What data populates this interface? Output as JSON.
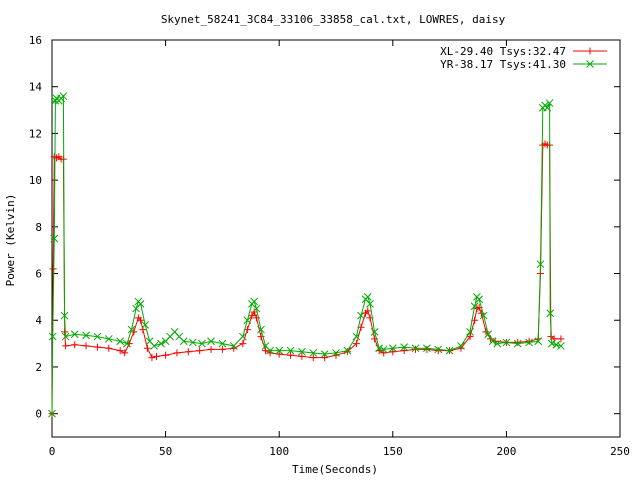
{
  "chart_data": {
    "type": "line",
    "title": "Skynet_58241_3C84_33106_33858_cal.txt, LOWRES, daisy",
    "xlabel": "Time(Seconds)",
    "ylabel": "Power (Kelvin)",
    "xlim": [
      0,
      250
    ],
    "ylim": [
      -1,
      16
    ],
    "xticks": [
      0,
      50,
      100,
      150,
      200,
      250
    ],
    "yticks": [
      0,
      2,
      4,
      6,
      8,
      10,
      12,
      14,
      16
    ],
    "grid": false,
    "legend_position": "top-right",
    "series": [
      {
        "name": "XL-29.40 Tsys:32.47",
        "color": "#ff0000",
        "marker": "+",
        "points": [
          [
            0,
            0
          ],
          [
            0.5,
            6.2
          ],
          [
            1,
            11.0
          ],
          [
            2,
            10.95
          ],
          [
            3,
            11.0
          ],
          [
            4,
            10.9
          ],
          [
            5,
            10.9
          ],
          [
            5.6,
            3.5
          ],
          [
            6,
            2.9
          ],
          [
            10,
            2.95
          ],
          [
            15,
            2.9
          ],
          [
            20,
            2.85
          ],
          [
            25,
            2.8
          ],
          [
            30,
            2.7
          ],
          [
            32,
            2.6
          ],
          [
            34,
            3.0
          ],
          [
            36,
            3.5
          ],
          [
            38,
            4.1
          ],
          [
            39,
            4.0
          ],
          [
            40,
            3.6
          ],
          [
            42,
            2.8
          ],
          [
            44,
            2.4
          ],
          [
            46,
            2.45
          ],
          [
            50,
            2.5
          ],
          [
            55,
            2.6
          ],
          [
            60,
            2.65
          ],
          [
            65,
            2.7
          ],
          [
            70,
            2.75
          ],
          [
            75,
            2.75
          ],
          [
            80,
            2.8
          ],
          [
            84,
            3.0
          ],
          [
            86,
            3.6
          ],
          [
            88,
            4.2
          ],
          [
            89,
            4.35
          ],
          [
            90,
            4.1
          ],
          [
            92,
            3.3
          ],
          [
            94,
            2.7
          ],
          [
            96,
            2.6
          ],
          [
            100,
            2.55
          ],
          [
            105,
            2.5
          ],
          [
            110,
            2.45
          ],
          [
            115,
            2.4
          ],
          [
            120,
            2.4
          ],
          [
            125,
            2.5
          ],
          [
            130,
            2.65
          ],
          [
            134,
            3.0
          ],
          [
            136,
            3.7
          ],
          [
            138,
            4.3
          ],
          [
            139,
            4.4
          ],
          [
            140,
            4.1
          ],
          [
            142,
            3.2
          ],
          [
            144,
            2.7
          ],
          [
            146,
            2.6
          ],
          [
            150,
            2.65
          ],
          [
            155,
            2.7
          ],
          [
            160,
            2.75
          ],
          [
            165,
            2.75
          ],
          [
            170,
            2.7
          ],
          [
            175,
            2.7
          ],
          [
            180,
            2.8
          ],
          [
            184,
            3.3
          ],
          [
            186,
            4.0
          ],
          [
            187,
            4.5
          ],
          [
            188,
            4.55
          ],
          [
            189,
            4.3
          ],
          [
            191,
            3.5
          ],
          [
            193,
            3.2
          ],
          [
            195,
            3.1
          ],
          [
            200,
            3.05
          ],
          [
            205,
            3.05
          ],
          [
            210,
            3.1
          ],
          [
            214,
            3.2
          ],
          [
            215,
            6.0
          ],
          [
            216,
            11.5
          ],
          [
            217,
            11.55
          ],
          [
            218,
            11.5
          ],
          [
            219,
            11.5
          ],
          [
            219.6,
            3.3
          ],
          [
            221,
            3.2
          ],
          [
            224,
            3.2
          ]
        ]
      },
      {
        "name": "YR-38.17 Tsys:41.30",
        "color": "#00aa00",
        "marker": "x",
        "points": [
          [
            0,
            0
          ],
          [
            0.3,
            3.3
          ],
          [
            1,
            7.5
          ],
          [
            1.5,
            13.4
          ],
          [
            2,
            13.5
          ],
          [
            3,
            13.4
          ],
          [
            4,
            13.5
          ],
          [
            5,
            13.6
          ],
          [
            5.5,
            4.2
          ],
          [
            6,
            3.3
          ],
          [
            10,
            3.4
          ],
          [
            15,
            3.35
          ],
          [
            20,
            3.3
          ],
          [
            25,
            3.2
          ],
          [
            30,
            3.1
          ],
          [
            33,
            3.0
          ],
          [
            35,
            3.6
          ],
          [
            37,
            4.5
          ],
          [
            38,
            4.8
          ],
          [
            39,
            4.7
          ],
          [
            41,
            3.8
          ],
          [
            43,
            3.1
          ],
          [
            45,
            2.9
          ],
          [
            48,
            3.0
          ],
          [
            50,
            3.1
          ],
          [
            52,
            3.3
          ],
          [
            54,
            3.5
          ],
          [
            56,
            3.3
          ],
          [
            58,
            3.1
          ],
          [
            62,
            3.05
          ],
          [
            66,
            3.0
          ],
          [
            70,
            3.1
          ],
          [
            75,
            3.0
          ],
          [
            80,
            2.9
          ],
          [
            84,
            3.3
          ],
          [
            86,
            4.0
          ],
          [
            88,
            4.7
          ],
          [
            89,
            4.8
          ],
          [
            90,
            4.5
          ],
          [
            92,
            3.6
          ],
          [
            94,
            2.9
          ],
          [
            96,
            2.7
          ],
          [
            100,
            2.7
          ],
          [
            105,
            2.7
          ],
          [
            110,
            2.65
          ],
          [
            115,
            2.6
          ],
          [
            120,
            2.55
          ],
          [
            125,
            2.6
          ],
          [
            130,
            2.7
          ],
          [
            134,
            3.3
          ],
          [
            136,
            4.2
          ],
          [
            138,
            4.9
          ],
          [
            139,
            5.0
          ],
          [
            140,
            4.7
          ],
          [
            142,
            3.5
          ],
          [
            144,
            2.8
          ],
          [
            146,
            2.75
          ],
          [
            150,
            2.8
          ],
          [
            155,
            2.85
          ],
          [
            160,
            2.8
          ],
          [
            165,
            2.8
          ],
          [
            170,
            2.75
          ],
          [
            175,
            2.7
          ],
          [
            180,
            2.9
          ],
          [
            184,
            3.5
          ],
          [
            186,
            4.6
          ],
          [
            187,
            5.0
          ],
          [
            188,
            4.9
          ],
          [
            190,
            4.2
          ],
          [
            192,
            3.4
          ],
          [
            194,
            3.1
          ],
          [
            196,
            3.0
          ],
          [
            200,
            3.05
          ],
          [
            205,
            3.0
          ],
          [
            210,
            3.05
          ],
          [
            214,
            3.1
          ],
          [
            215,
            6.4
          ],
          [
            216,
            13.1
          ],
          [
            217,
            13.2
          ],
          [
            218,
            13.1
          ],
          [
            219,
            13.3
          ],
          [
            219.3,
            4.3
          ],
          [
            220,
            3.0
          ],
          [
            222,
            2.95
          ],
          [
            224,
            2.9
          ]
        ]
      }
    ]
  }
}
